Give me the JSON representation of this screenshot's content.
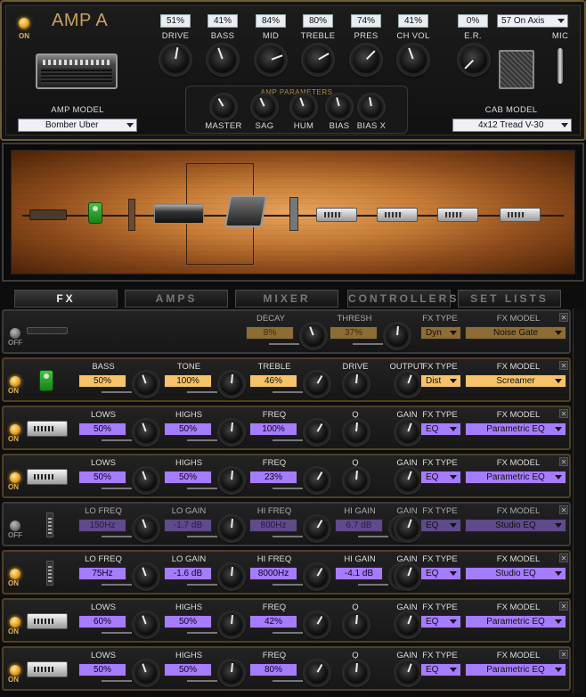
{
  "amp": {
    "name": "AMP A",
    "power": "ON",
    "model_label": "AMP MODEL",
    "model": "Bomber Uber",
    "knobs": [
      {
        "label": "DRIVE",
        "value": "51%"
      },
      {
        "label": "BASS",
        "value": "41%"
      },
      {
        "label": "MID",
        "value": "84%"
      },
      {
        "label": "TREBLE",
        "value": "80%"
      },
      {
        "label": "PRES",
        "value": "74%"
      },
      {
        "label": "CH VOL",
        "value": "41%"
      }
    ],
    "params_title": "AMP PARAMETERS",
    "params": [
      "MASTER",
      "SAG",
      "HUM",
      "BIAS",
      "BIAS X"
    ],
    "er_label": "E.R.",
    "er_value": "0%",
    "mic_position": "57 On Axis",
    "mic_label": "MIC",
    "cab_label": "CAB MODEL",
    "cab_model": "4x12 Tread V-30"
  },
  "tabs": [
    {
      "label": "FX",
      "active": true
    },
    {
      "label": "AMPS"
    },
    {
      "label": "MIXER"
    },
    {
      "label": "CONTROLLERS"
    },
    {
      "label": "SET LISTS"
    }
  ],
  "fx_type_label": "FX TYPE",
  "fx_model_label": "FX MODEL",
  "rows": [
    {
      "power": "OFF",
      "icon": "noise-gate-icon",
      "params": [
        {
          "label": "DECAY",
          "value": "8%"
        },
        {
          "label": "THRESH",
          "value": "37%"
        }
      ],
      "type": "Dyn",
      "model": "Noise Gate"
    },
    {
      "power": "ON",
      "icon": "screamer-pedal-icon",
      "params": [
        {
          "label": "BASS",
          "value": "50%"
        },
        {
          "label": "TONE",
          "value": "100%"
        },
        {
          "label": "TREBLE",
          "value": "46%"
        },
        {
          "label": "DRIVE",
          "value": ""
        },
        {
          "label": "OUTPUT",
          "value": ""
        }
      ],
      "type": "Dist",
      "model": "Screamer"
    },
    {
      "power": "ON",
      "icon": "parametric-eq-icon",
      "params": [
        {
          "label": "LOWS",
          "value": "50%"
        },
        {
          "label": "HIGHS",
          "value": "50%"
        },
        {
          "label": "FREQ",
          "value": "100%"
        },
        {
          "label": "Q",
          "value": ""
        },
        {
          "label": "GAIN",
          "value": ""
        }
      ],
      "type": "EQ",
      "model": "Parametric EQ"
    },
    {
      "power": "ON",
      "icon": "parametric-eq-icon",
      "params": [
        {
          "label": "LOWS",
          "value": "50%"
        },
        {
          "label": "HIGHS",
          "value": "50%"
        },
        {
          "label": "FREQ",
          "value": "23%"
        },
        {
          "label": "Q",
          "value": ""
        },
        {
          "label": "GAIN",
          "value": ""
        }
      ],
      "type": "EQ",
      "model": "Parametric EQ"
    },
    {
      "power": "OFF",
      "icon": "studio-eq-icon",
      "params": [
        {
          "label": "LO FREQ",
          "value": "150Hz"
        },
        {
          "label": "LO GAIN",
          "value": "-1.7 dB"
        },
        {
          "label": "HI FREQ",
          "value": "800Hz"
        },
        {
          "label": "HI GAIN",
          "value": "6.7 dB"
        },
        {
          "label": "GAIN",
          "value": ""
        }
      ],
      "type": "EQ",
      "model": "Studio EQ"
    },
    {
      "power": "ON",
      "icon": "studio-eq-icon",
      "params": [
        {
          "label": "LO FREQ",
          "value": "75Hz"
        },
        {
          "label": "LO GAIN",
          "value": "-1.6 dB"
        },
        {
          "label": "HI FREQ",
          "value": "8000Hz"
        },
        {
          "label": "HI GAIN",
          "value": "-4.1 dB"
        },
        {
          "label": "GAIN",
          "value": ""
        }
      ],
      "type": "EQ",
      "model": "Studio EQ"
    },
    {
      "power": "ON",
      "icon": "parametric-eq-icon",
      "params": [
        {
          "label": "LOWS",
          "value": "60%"
        },
        {
          "label": "HIGHS",
          "value": "50%"
        },
        {
          "label": "FREQ",
          "value": "42%"
        },
        {
          "label": "Q",
          "value": ""
        },
        {
          "label": "GAIN",
          "value": ""
        }
      ],
      "type": "EQ",
      "model": "Parametric EQ"
    },
    {
      "power": "ON",
      "icon": "parametric-eq-icon",
      "params": [
        {
          "label": "LOWS",
          "value": "50%"
        },
        {
          "label": "HIGHS",
          "value": "50%"
        },
        {
          "label": "FREQ",
          "value": "80%"
        },
        {
          "label": "Q",
          "value": ""
        },
        {
          "label": "GAIN",
          "value": ""
        }
      ],
      "type": "EQ",
      "model": "Parametric EQ"
    }
  ],
  "colors": {
    "accent": "#e7b24a",
    "purple": "#a67cff",
    "orange": "#f6c36a",
    "frame": "#6b5a36"
  }
}
